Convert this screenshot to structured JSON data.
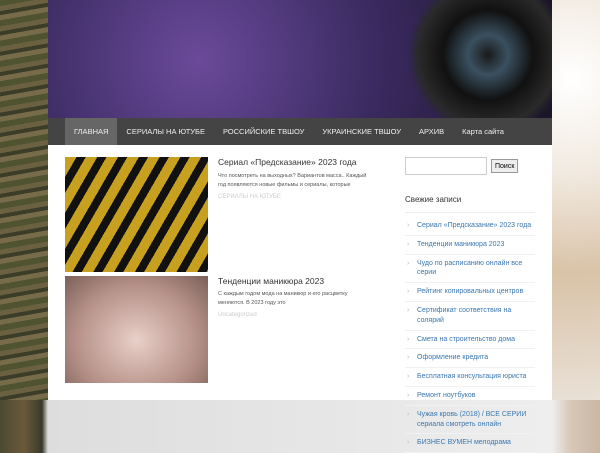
{
  "nav": [
    "ГЛАВНАЯ",
    "СЕРИАЛЫ НА ЮТУБЕ",
    "РОССИЙСКИЕ ТВШОУ",
    "УКРАИНСКИЕ ТВШОУ",
    "АРХИВ",
    "Карта сайта"
  ],
  "posts": [
    {
      "title": "Сериал «Предсказание» 2023 года",
      "excerpt": "Что посмотреть на выходных? Вариантов масса.. Каждый год появляются новые фильмы и сериалы, которые",
      "category": "СЕРИАЛЫ НА ЮТУБЕ"
    },
    {
      "title": "Тенденции маникюра 2023",
      "excerpt": "С каждым годом мода на маникюр и его расцветку меняются. В 2023 году это",
      "category": "Uncategorized"
    }
  ],
  "sidebar": {
    "search_button": "Поиск",
    "widget_title": "Свежие записи",
    "items": [
      "Сериал «Предсказание» 2023 года",
      "Тенденции маникюра 2023",
      "Чудо по расписанию онлайн все серии",
      "Рейтинг копировальных центров",
      "Сертификат соответствия на солярий",
      "Смета на строительство дома",
      "Оформление кредита",
      "Бесплатная консультация юриста",
      "Ремонт ноутбуков",
      "Чужая кровь (2018) / ВСЕ СЕРИИ сериала смотреть онлайн",
      "БИЗНЕС ВУМЕН мелодрама"
    ]
  }
}
